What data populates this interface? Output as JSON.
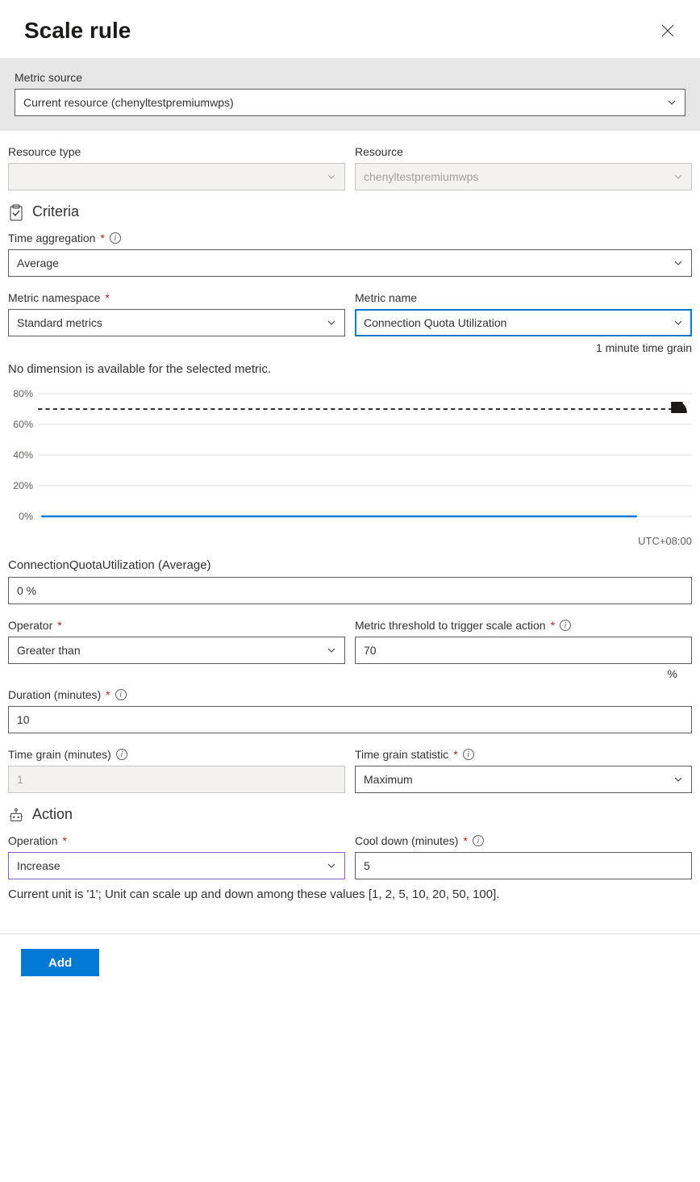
{
  "header": {
    "title": "Scale rule"
  },
  "metricSource": {
    "label": "Metric source",
    "value": "Current resource (chenyltestpremiumwps)"
  },
  "resourceType": {
    "label": "Resource type",
    "value": ""
  },
  "resource": {
    "label": "Resource",
    "value": "chenyltestpremiumwps"
  },
  "criteria": {
    "heading": "Criteria",
    "timeAggregation": {
      "label": "Time aggregation",
      "value": "Average"
    },
    "metricNamespace": {
      "label": "Metric namespace",
      "value": "Standard metrics"
    },
    "metricName": {
      "label": "Metric name",
      "value": "Connection Quota Utilization",
      "grain": "1 minute time grain"
    },
    "dimensionNote": "No dimension is available for the selected metric.",
    "readoutLabel": "ConnectionQuotaUtilization (Average)",
    "readoutValue": "0 %",
    "operator": {
      "label": "Operator",
      "value": "Greater than"
    },
    "threshold": {
      "label": "Metric threshold to trigger scale action",
      "value": "70",
      "unit": "%"
    },
    "duration": {
      "label": "Duration (minutes)",
      "value": "10"
    },
    "timeGrain": {
      "label": "Time grain (minutes)",
      "value": "1"
    },
    "timeGrainStatistic": {
      "label": "Time grain statistic",
      "value": "Maximum"
    }
  },
  "action": {
    "heading": "Action",
    "operation": {
      "label": "Operation",
      "value": "Increase"
    },
    "cooldown": {
      "label": "Cool down (minutes)",
      "value": "5"
    },
    "hint": "Current unit is '1'; Unit can scale up and down among these values [1, 2, 5, 10, 20, 50, 100]."
  },
  "footer": {
    "add": "Add"
  },
  "chart_data": {
    "type": "line",
    "title": "",
    "ylabel": "",
    "ylim": [
      0,
      80
    ],
    "yticks": [
      "0%",
      "20%",
      "40%",
      "60%",
      "80%"
    ],
    "threshold_line": 70,
    "series": [
      {
        "name": "ConnectionQuotaUtilization (Average)",
        "values": [
          0,
          0,
          0,
          0,
          0,
          0,
          0,
          0,
          0,
          0,
          0,
          0,
          0,
          0,
          0,
          0,
          0,
          0,
          0,
          0
        ],
        "color": "#0078d4"
      }
    ],
    "timezone": "UTC+08:00"
  }
}
